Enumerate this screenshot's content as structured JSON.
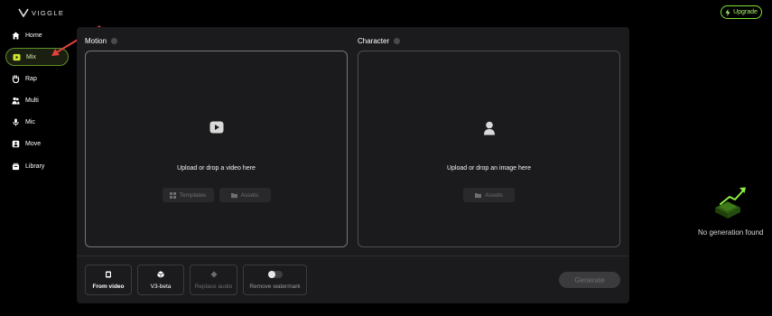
{
  "brand": {
    "name": "VIGGLE",
    "logo_icon": "viggle-v-logo"
  },
  "header": {
    "upgrade_label": "Upgrade",
    "upgrade_icon": "bolt-icon",
    "accent": "#7fe23a"
  },
  "sidebar": {
    "items": [
      {
        "label": "Home",
        "icon": "home-icon",
        "active": false
      },
      {
        "label": "Mix",
        "icon": "play-icon",
        "active": true
      },
      {
        "label": "Rap",
        "icon": "hand-icon",
        "active": false
      },
      {
        "label": "Multi",
        "icon": "people-icon",
        "active": false
      },
      {
        "label": "Mic",
        "icon": "mic-icon",
        "active": false
      },
      {
        "label": "Move",
        "icon": "person-icon",
        "active": false
      },
      {
        "label": "Library",
        "icon": "library-icon",
        "active": false
      }
    ]
  },
  "motion": {
    "title": "Motion",
    "upload_text": "Upload or drop a video here",
    "templates_label": "Templates",
    "assets_label": "Assets"
  },
  "character": {
    "title": "Character",
    "upload_text": "Upload or drop an image here",
    "assets_label": "Assets"
  },
  "options": {
    "from_video": "From video",
    "v3_beta": "V3-beta",
    "replace_audio": "Replace audio",
    "remove_watermark": "Remove watermark"
  },
  "generate_label": "Generate",
  "empty_state": {
    "text": "No generation found"
  }
}
